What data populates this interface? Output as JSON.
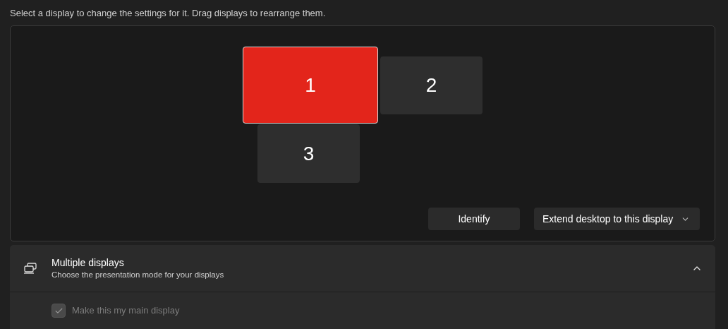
{
  "instruction": "Select a display to change the settings for it. Drag displays to rearrange them.",
  "displays": [
    {
      "label": "1",
      "selected": true
    },
    {
      "label": "2",
      "selected": false
    },
    {
      "label": "3",
      "selected": false
    }
  ],
  "identify_button": "Identify",
  "mode_dropdown": {
    "value": "Extend desktop to this display"
  },
  "multiple_displays": {
    "title": "Multiple displays",
    "subtitle": "Choose the presentation mode for your displays",
    "expanded": true,
    "options": [
      {
        "label": "Make this my main display",
        "checked": true,
        "disabled": true
      }
    ]
  }
}
